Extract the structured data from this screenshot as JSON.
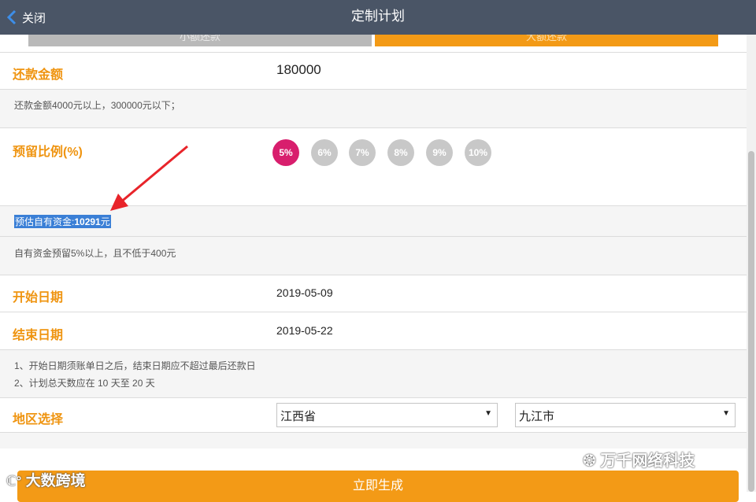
{
  "nav": {
    "back_label": "关闭",
    "title": "定制计划"
  },
  "tabs": {
    "small_label": "小额还款",
    "large_label": "大额还款"
  },
  "repayment": {
    "label": "还款金额",
    "value": "180000",
    "note": "还款金额4000元以上，300000元以下；"
  },
  "reserve": {
    "label": "预留比例(%)",
    "options": [
      "5%",
      "6%",
      "7%",
      "8%",
      "9%",
      "10%"
    ],
    "selected": "5%",
    "estimate_prefix": "预估自有资金:",
    "estimate_value": "10291",
    "estimate_unit": "元",
    "note": "自有资金预留5%以上，且不低于400元"
  },
  "start": {
    "label": "开始日期",
    "value": "2019-05-09"
  },
  "end": {
    "label": "结束日期",
    "value": "2019-05-22"
  },
  "date_notes": [
    "1、开始日期须账单日之后，结束日期应不超过最后还款日",
    "2、计划总天数应在 10 天至 20 天"
  ],
  "region": {
    "label": "地区选择",
    "province": "江西省",
    "city": "九江市"
  },
  "generate_button": "立即生成",
  "watermarks": {
    "left": "大数跨境",
    "right": "万千网络科技"
  },
  "colors": {
    "accent": "#f39a16",
    "label": "#ef9410",
    "selected": "#d81e6d",
    "navbar": "#4a5566",
    "arrow": "#e8242a"
  }
}
